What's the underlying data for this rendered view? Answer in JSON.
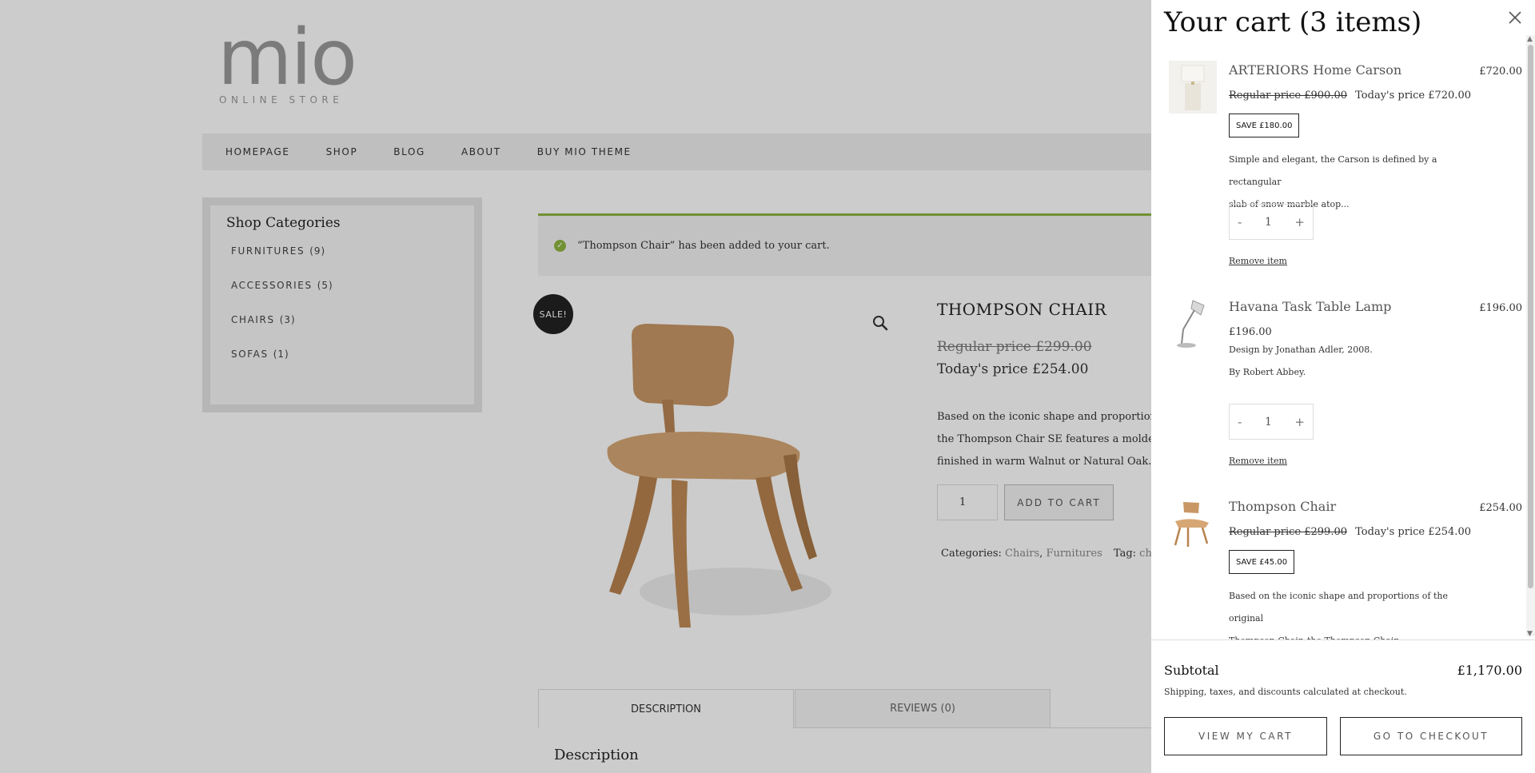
{
  "site": {
    "logo_mark": "mio",
    "logo_sub": "ONLINE STORE"
  },
  "nav": {
    "items": [
      "HOMEPAGE",
      "SHOP",
      "BLOG",
      "ABOUT",
      "BUY MIO THEME"
    ]
  },
  "sidebar": {
    "title": "Shop Categories",
    "categories": [
      {
        "label": "FURNITURES",
        "count": "(9)"
      },
      {
        "label": "ACCESSORIES",
        "count": "(5)"
      },
      {
        "label": "CHAIRS",
        "count": "(3)"
      },
      {
        "label": "SOFAS",
        "count": "(1)"
      }
    ]
  },
  "notice": {
    "text": "“Thompson Chair” has been added to your cart."
  },
  "product": {
    "sale_badge": "SALE!",
    "title": "THOMPSON CHAIR",
    "price_regular": "Regular price £299.00",
    "price_today": "Today's price £254.00",
    "desc_lines": [
      "Based on the iconic shape and proportions of",
      "the Thompson Chair SE features a molded ply",
      "finished in warm Walnut or Natural Oak."
    ],
    "qty": "1",
    "add_to_cart": "ADD TO CART",
    "categories_label": "Categories:",
    "category_1": "Chairs",
    "category_sep": ",",
    "category_2": "Furnitures",
    "tag_label": "Tag:",
    "tag": "chair"
  },
  "tabs": {
    "description": "DESCRIPTION",
    "reviews": "REVIEWS (0)",
    "heading": "Description"
  },
  "cart": {
    "title": "Your cart (3 items)",
    "items": [
      {
        "name": "ARTERIORS Home Carson",
        "total": "£720.00",
        "regular": "Regular price £900.00",
        "today": "Today's price £720.00",
        "save": "SAVE £180.00",
        "desc_1": "Simple and elegant, the Carson is defined by a rectangular",
        "desc_2": "slab of snow marble atop...",
        "qty": "1",
        "remove": "Remove item"
      },
      {
        "name": "Havana Task Table Lamp",
        "total": "£196.00",
        "price": "£196.00",
        "desc_1": "Design by Jonathan Adler, 2008.",
        "desc_2": "By Robert Abbey.",
        "qty": "1",
        "remove": "Remove item"
      },
      {
        "name": "Thompson Chair",
        "total": "£254.00",
        "regular": "Regular price £299.00",
        "today": "Today's price £254.00",
        "save": "SAVE £45.00",
        "desc_1": "Based on the iconic shape and proportions of the original",
        "desc_2": "Thompson Chair, the Thompson Chair..."
      }
    ],
    "subtotal_label": "Subtotal",
    "subtotal_value": "£1,170.00",
    "note": "Shipping, taxes, and discounts calculated at checkout.",
    "view_cart": "VIEW MY CART",
    "checkout": "GO TO CHECKOUT"
  },
  "icons": {
    "check": "check-circle-icon",
    "zoom": "magnifier-icon",
    "close": "close-icon"
  },
  "colors": {
    "accent_green": "#8fb640",
    "overlay": "rgba(0,0,0,0.2)"
  }
}
